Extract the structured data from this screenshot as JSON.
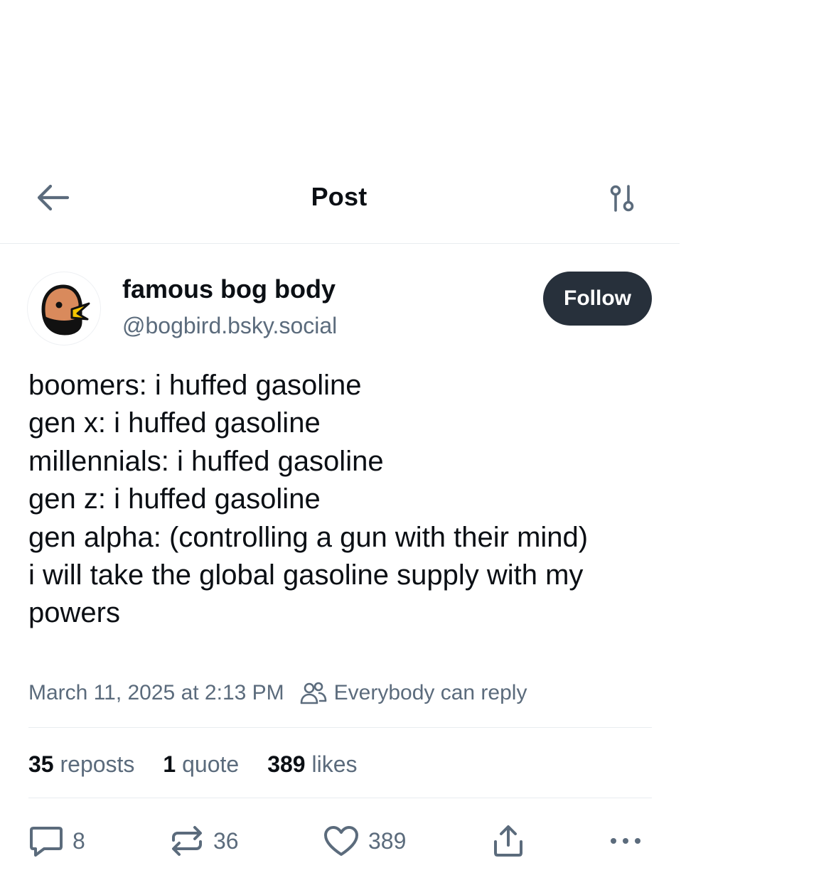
{
  "header": {
    "title": "Post",
    "back_icon": "arrow-left-icon",
    "settings_icon": "sliders-icon"
  },
  "author": {
    "display_name": "famous bog body",
    "handle": "@bogbird.bsky.social",
    "follow_label": "Follow"
  },
  "post": {
    "lines": [
      "boomers: i huffed gasoline",
      "gen x: i huffed gasoline",
      "millennials: i huffed gasoline",
      "gen z: i huffed gasoline",
      "gen alpha: (controlling a gun with their mind)",
      "i will take the global gasoline supply with my",
      "powers"
    ],
    "date": "March 11, 2025 at 2:13 PM",
    "reply_setting": "Everybody can reply"
  },
  "stats": {
    "reposts_count": "35",
    "reposts_label": "reposts",
    "quotes_count": "1",
    "quotes_label": "quote",
    "likes_count": "389",
    "likes_label": "likes"
  },
  "actions": {
    "reply_count": "8",
    "repost_count": "36",
    "like_count": "389"
  },
  "colors": {
    "text_primary": "#0b0f14",
    "text_muted": "#5b6b7c",
    "follow_bg": "#27303b",
    "divider": "#e8ecf0"
  }
}
